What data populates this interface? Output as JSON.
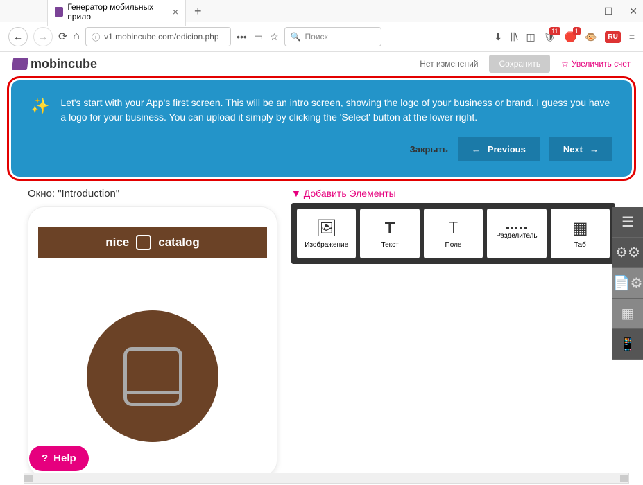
{
  "browser": {
    "tab_title": "Генератор мобильных прило",
    "url": "v1.mobincube.com/edicion.php",
    "search_placeholder": "Поиск",
    "ru_badge": "RU",
    "badge_11": "11",
    "badge_1": "1"
  },
  "header": {
    "logo_text": "mobincube",
    "no_changes": "Нет изменений",
    "save": "Сохранить",
    "upgrade": "Увеличить счет"
  },
  "banner": {
    "text": "Let's start with your App's first screen. This will be an intro screen, showing the logo of your business or brand. I guess you have a logo for your business. You can upload it simply by clicking the 'Select' button at the lower right.",
    "close": "Закрыть",
    "previous": "Previous",
    "next": "Next"
  },
  "editor": {
    "window_label": "Окно: \"Introduction\"",
    "phone_title_1": "nice",
    "phone_title_2": "catalog",
    "add_prefix": "▼ Добавить ",
    "add_link": "Элементы"
  },
  "elements": {
    "image": "Изображение",
    "text": "Текст",
    "field": "Поле",
    "divider": "Разделитель",
    "table": "Таб"
  },
  "help": "Help"
}
